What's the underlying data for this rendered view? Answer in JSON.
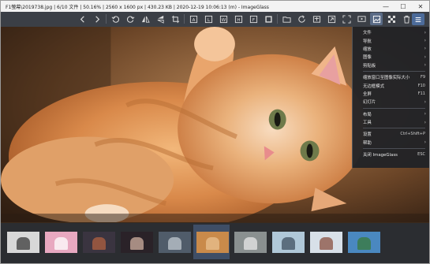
{
  "window": {
    "title": "F1螢幕\\2019738.jpg  |  6/10 文件  |  50.16%  |  2560 x 1600 px  |  430.23 KB  |  2020-12-19 10:06:13 (m)  - ImageGlass"
  },
  "titlebar_buttons": [
    "—",
    "☐",
    "✕"
  ],
  "context_menu": {
    "groups": [
      [
        {
          "label": "文件",
          "submenu": true
        },
        {
          "label": "导航",
          "submenu": true
        },
        {
          "label": "缩放",
          "submenu": true
        },
        {
          "label": "图像",
          "submenu": true
        },
        {
          "label": "剪贴板",
          "submenu": true
        }
      ],
      [
        {
          "label": "缩放窗口至图像实际大小",
          "shortcut": "F9"
        },
        {
          "label": "无边框模式",
          "shortcut": "F10"
        },
        {
          "label": "全屏",
          "shortcut": "F11"
        },
        {
          "label": "幻灯片",
          "submenu": true
        }
      ],
      [
        {
          "label": "布局",
          "submenu": true
        },
        {
          "label": "工具",
          "submenu": true
        }
      ],
      [
        {
          "label": "设置",
          "shortcut": "Ctrl+Shift+P"
        },
        {
          "label": "帮助",
          "submenu": true
        }
      ],
      [
        {
          "label": "关闭 ImageGlass",
          "shortcut": "ESC"
        }
      ]
    ]
  },
  "thumbnails": [
    {
      "name": "thumb-1",
      "color": "#d8d8d8",
      "accent": "#3a3a3a"
    },
    {
      "name": "thumb-2",
      "color": "#e8a8c0",
      "accent": "#ffffff"
    },
    {
      "name": "thumb-3",
      "color": "#3a3440",
      "accent": "#b06040"
    },
    {
      "name": "thumb-4",
      "color": "#2a2228",
      "accent": "#d0b0a0"
    },
    {
      "name": "thumb-5",
      "color": "#505c6a",
      "accent": "#c0c8d0"
    },
    {
      "name": "thumb-6",
      "color": "#c98a4a",
      "accent": "#e8c090"
    },
    {
      "name": "thumb-7",
      "color": "#8a9090",
      "accent": "#e8e8e8"
    },
    {
      "name": "thumb-8",
      "color": "#b0c8d8",
      "accent": "#405060"
    },
    {
      "name": "thumb-9",
      "color": "#d8e0e8",
      "accent": "#8a5040"
    },
    {
      "name": "thumb-10",
      "color": "#4a88c0",
      "accent": "#3a7a3a"
    }
  ],
  "colors": {
    "toolbar": "#3b3f46",
    "accent": "#4c6b9a",
    "menu_bg": "#202226",
    "thumb_selected": "#3f4e66"
  }
}
